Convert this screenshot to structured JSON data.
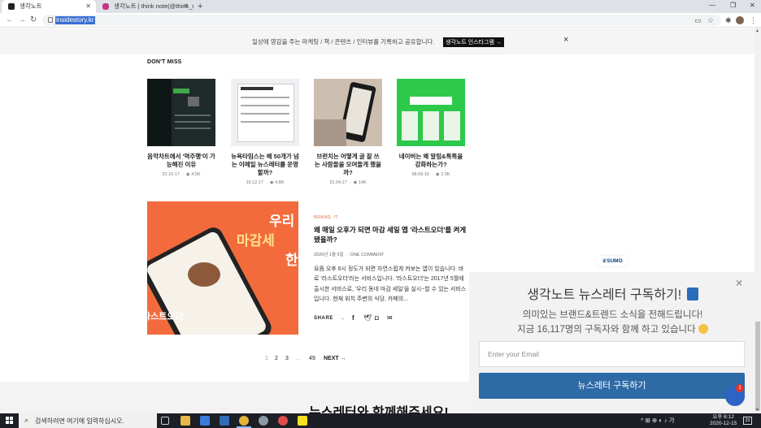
{
  "browser": {
    "tabs": [
      {
        "label": "생각노트",
        "active": true
      },
      {
        "label": "생각노트 | think note(@think_n…",
        "active": false
      }
    ],
    "url": "insidestory.kr"
  },
  "top_banner": {
    "message": "일상에 영감을 주는 마케팅 / 책 / 콘텐츠 / 인터뷰를 기록하고 공유합니다.",
    "button": "생각노트 인스타그램 →",
    "close": "×"
  },
  "section_label": "DON'T MISS",
  "cards": [
    {
      "title": "음악차트에서 '역주행'이 가능해진 이유",
      "date": "22.10.17",
      "views": "4.5K"
    },
    {
      "title": "뉴욕타임스는 왜 50개가 넘는 이메일 뉴스레터를 운영할까?",
      "date": "10.12.17",
      "views": "4.8K"
    },
    {
      "title": "브런치는 어떻게 글 잘 쓰는 사람들을 모여들게 했을까?",
      "date": "15.04.17",
      "views": "14K"
    },
    {
      "title": "네이버는 왜 알림&톡톡을 강화하는가?",
      "date": "08.09.16",
      "views": "2.3K"
    }
  ],
  "feature": {
    "category": "BRAND,  IT",
    "title": "왜 매일 오후가 되면 마감 세일 앱 '라스트오더'를 켜게 됐을까?",
    "date": "2020년 1월 5일",
    "comments": "ONE COMMENT",
    "excerpt": "요즘 오후 6시 정도가 되면 자연스럽게 켜보는 앱이 있습니다. 바로 '라스트오더'라는 서비스입니다. '라스트오더'는 2017년 5월에 출시한 서비스로, '우리 동네 마감 세일'을 실시~할 수 있는 서비스입니다. 현재 위치 주변의 식당, 카페의...",
    "share_label": "SHARE",
    "image_texts": [
      "우리",
      "마감세",
      "한",
      "라스트오더"
    ]
  },
  "pagination": {
    "items": [
      "1",
      "2",
      "3",
      "...",
      "49"
    ],
    "next": "NEXT →"
  },
  "newsletter_band_title": "뉴스레터와 함께해주세요!",
  "sumo": {
    "badge": "SUMO",
    "heading": "생각노트 뉴스레터 구독하기!",
    "line1": "의미있는 브랜드&트렌드 소식을 전해드립니다!",
    "line2": "지금 16,117명의 구독자와 함께 하고 있습니다",
    "email_placeholder": "Enter your Email",
    "button": "뉴스레터 구독하기",
    "close": "×",
    "chat_badge": "1"
  },
  "taskbar": {
    "search_placeholder": "검색하려면 여기에 입력하십시오.",
    "tray_text": "^ ⊞ ⊕ ◐ ♪ 가",
    "time": "오후 6:12",
    "date": "2020-12-15",
    "notifications": "23"
  }
}
